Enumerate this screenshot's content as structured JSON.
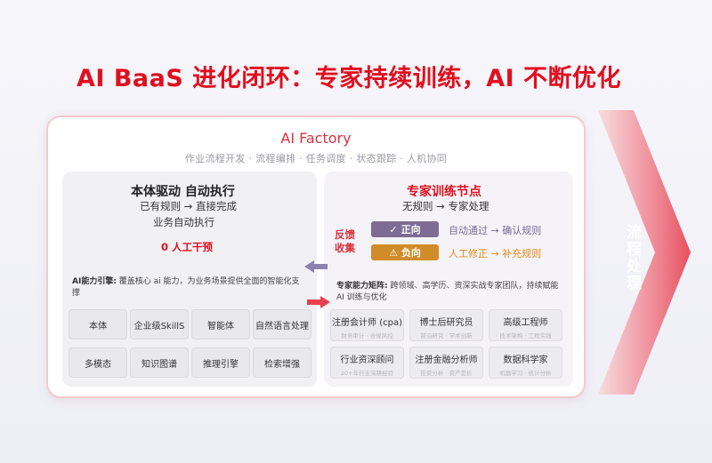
{
  "headline": "AI BaaS 进化闭环：专家持续训练，AI 不断优化",
  "factory": {
    "title": "AI Factory",
    "subtitle": "作业流程开发 · 流程编排 · 任务调度 · 状态跟踪 · 人机协同"
  },
  "left": {
    "title": "本体驱动 自动执行",
    "line1": "已有规则 → 直接完成",
    "line2": "业务自动执行",
    "zero": "0 人工干预",
    "engine_label": "AI能力引擎:",
    "engine_desc": "覆盖核心 ai 能力，为业务场景提供全面的智能化支撑",
    "chips": [
      "本体",
      "企业级SkillS",
      "智能体",
      "自然语言处理",
      "多模态",
      "知识图谱",
      "推理引擎",
      "检索增强"
    ]
  },
  "right": {
    "title": "专家训练节点",
    "line1": "无规则 → 专家处理",
    "vote": [
      "反馈",
      "收集"
    ],
    "positive": {
      "icon": "✓",
      "label": "正向",
      "desc": "自动通过 → 确认规则"
    },
    "negative": {
      "icon": "⚠",
      "label": "负向",
      "desc": "人工修正 → 补充规则"
    },
    "matrix_label": "专家能力矩阵:",
    "matrix_desc": "跨领域、高学历、资深实战专家团队，持续赋能 AI 训练与优化",
    "experts": [
      {
        "title": "注册会计师 (cpa)",
        "sub": "财务审计 · 合规风控"
      },
      {
        "title": "博士后研究员",
        "sub": "前沿研究 · 学术创新"
      },
      {
        "title": "高级工程师",
        "sub": "技术架构 · 工程实践"
      },
      {
        "title": "行业资深顾问",
        "sub": "20+年行业深耕经验"
      },
      {
        "title": "注册金融分析师",
        "sub": "投资分析 · 资产定价"
      },
      {
        "title": "数据科学家",
        "sub": "机器学习 · 统计分析"
      }
    ]
  },
  "side_arrow_text": "流程处理",
  "colors": {
    "accent": "#e10f1e",
    "purple": "#7d6c94",
    "orange": "#d18c2a"
  }
}
